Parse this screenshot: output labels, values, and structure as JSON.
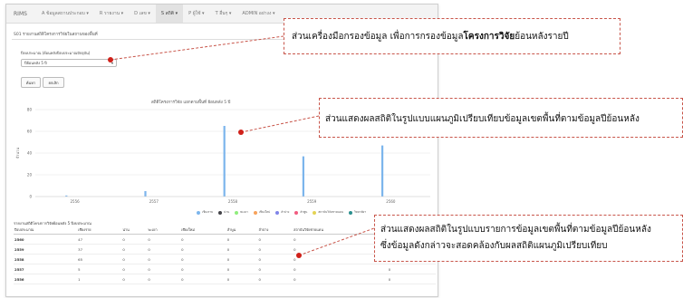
{
  "navbar": {
    "brand": "RIMS",
    "items": [
      "A ข้อมูลสถานประกอบ ▾",
      "R รายงาน ▾",
      "D เลข ▾",
      "S สถิติ ▾",
      "P ผู้ใช้ ▾",
      "T อื่นๆ ▾",
      "ADMIN อย่างง ▾"
    ],
    "active_index": 3
  },
  "panel": {
    "heading": "S01 รายงานสถิติโครงการวิจัยในสถานของพื้นที่"
  },
  "filter": {
    "label": "ปีงบประมาณ (ย้อนหลังปีงบประมาณปัจจุบัน)",
    "selected": "ปีย้อนหลัง 5 ปี",
    "search_button": "ค้นหา",
    "clear_button": "ยกเลิก"
  },
  "chart_data": {
    "type": "bar",
    "title": "สถิติโครงการวิจัย แยกตามพื้นที่ ย้อนหลัง 5 ปี",
    "categories": [
      "2556",
      "2557",
      "2558",
      "2559",
      "2560"
    ],
    "ylim": [
      0,
      80
    ],
    "yticks": [
      "0",
      "20",
      "40",
      "60",
      "80"
    ],
    "ylabel": "จำนวน",
    "series": [
      {
        "name": "เชียงราย",
        "color": "#7cb5ec",
        "values": [
          1,
          5,
          65,
          37,
          47
        ]
      },
      {
        "name": "น่าน",
        "color": "#434348",
        "values": [
          0,
          0,
          0,
          0,
          0
        ]
      },
      {
        "name": "พะเยา",
        "color": "#90ed7d",
        "values": [
          0,
          0,
          0,
          0,
          0
        ]
      },
      {
        "name": "เชียงใหม่",
        "color": "#f7a35c",
        "values": [
          0,
          0,
          0,
          0,
          0
        ]
      },
      {
        "name": "ลำปาง",
        "color": "#8085e9",
        "values": [
          0,
          0,
          0,
          0,
          0
        ]
      },
      {
        "name": "ลำพูน",
        "color": "#f15c80",
        "values": [
          0,
          0,
          0,
          0,
          0
        ]
      },
      {
        "name": "สถาบันวิจัยชายแดน",
        "color": "#e4d354",
        "values": [
          0,
          0,
          0,
          0,
          0
        ]
      },
      {
        "name": "วิทยาลัยฯ",
        "color": "#2b908f",
        "values": [
          0,
          0,
          0,
          0,
          0
        ]
      }
    ],
    "legend": "bottom"
  },
  "table": {
    "title": "รายงานสถิติโครงการวิจัยย้อนหลัง 5 ปีงบประมาณ",
    "headers": [
      "ปีงบประมาณ",
      "เชียงราย",
      "น่าน",
      "พะเยา",
      "เชียงใหม่",
      "ลำพูน",
      "ลำปาง",
      "สถาบันวิจัยชายแดน",
      "วิทยาลัยฯ"
    ],
    "rows": [
      [
        "2560",
        "47",
        "0",
        "0",
        "0",
        "0",
        "0",
        "0",
        "0"
      ],
      [
        "2559",
        "37",
        "0",
        "0",
        "0",
        "0",
        "0",
        "0",
        "0"
      ],
      [
        "2558",
        "65",
        "0",
        "0",
        "0",
        "0",
        "0",
        "0",
        "0"
      ],
      [
        "2557",
        "5",
        "0",
        "0",
        "0",
        "0",
        "0",
        "0",
        "0"
      ],
      [
        "2556",
        "1",
        "0",
        "0",
        "0",
        "0",
        "0",
        "0",
        "0"
      ]
    ]
  },
  "callouts": {
    "filter_note_prefix": "ส่วนเครื่องมือกรองข้อมูล เพื่อการกรองข้อมูล",
    "filter_note_bold": "โครงการวิจัย",
    "filter_note_suffix": "ย้อนหลังรายปี",
    "chart_note": "ส่วนแสดงผลสถิติในรูปแบบแผนภูมิเปรียบเทียบข้อมูลเขตพื้นที่ตามข้อมูลปีย้อนหลัง",
    "table_note_line1": "ส่วนแสดงผลสถิติในรูปแบบรายการข้อมูลเขตพื้นที่ตามข้อมูลปีย้อนหลัง",
    "table_note_line2": "ซึ่งข้อมูลดังกล่าวจะสอดคล้องกับผลสถิติแผนภูมิเปรียบเทียบ"
  },
  "colors": {
    "accent_red": "#c8554a",
    "bar_blue": "#7cb5ec"
  }
}
